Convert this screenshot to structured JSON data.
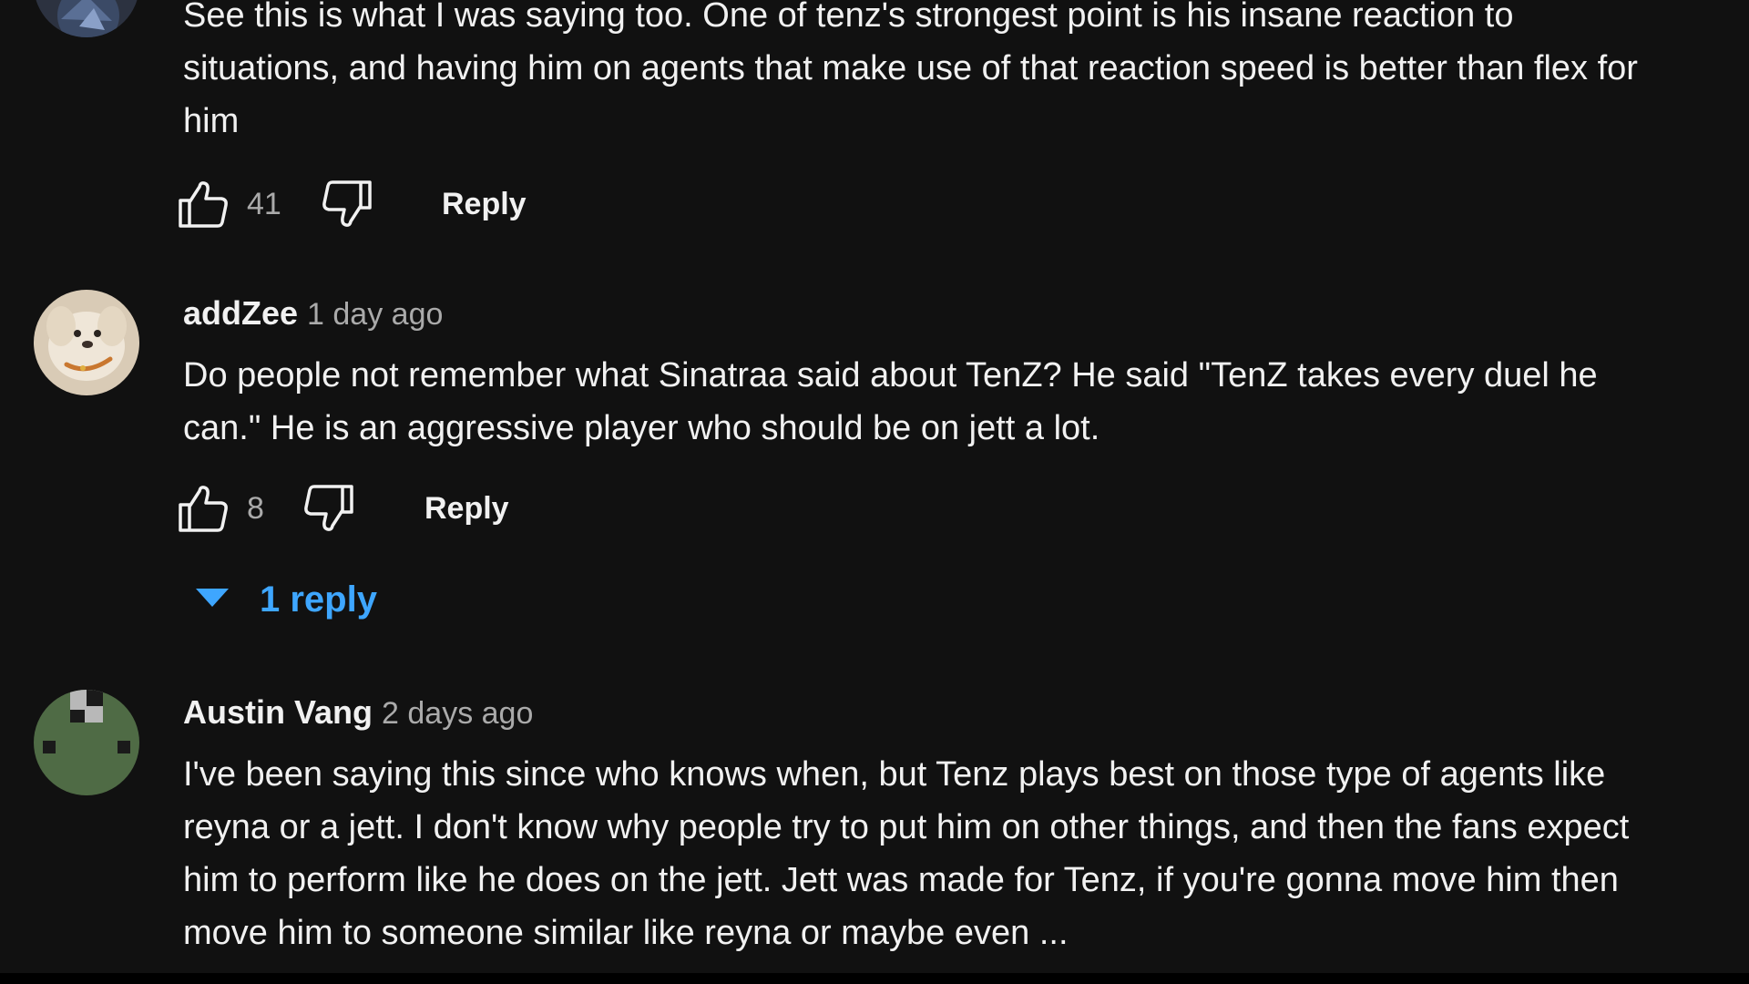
{
  "comments": [
    {
      "author": "",
      "time": "",
      "text": "See this is what I was saying too. One of tenz's strongest point is his insane reaction to situations, and having him on agents that make use of that reaction speed is better than flex for him",
      "likes": "41",
      "reply_label": "Reply",
      "avatar_icon": "avatar-image-partial"
    },
    {
      "author": "addZee",
      "time": "1 day ago",
      "text": "Do people not remember what Sinatraa said about TenZ? He said \"TenZ takes every duel he can.\" He is an aggressive player who should be on jett a lot.",
      "likes": "8",
      "reply_label": "Reply",
      "replies_label": "1 reply",
      "avatar_icon": "dog-avatar"
    },
    {
      "author": "Austin Vang",
      "time": "2 days ago",
      "text": "I've been saying this since who knows when, but Tenz plays best on those type of agents like reyna or a jett. I don't know why people try to put him on other things, and then the fans expect him to perform like he does on the jett. Jett was made for Tenz, if you're gonna move him then move him to someone similar like reyna or maybe even ...",
      "avatar_icon": "green-pixel-avatar"
    }
  ],
  "colors": {
    "background": "#111111",
    "text": "#f1f1f1",
    "secondary_text": "#aaaaaa",
    "link_blue": "#3ea6ff"
  },
  "icons": {
    "like": "thumbs-up-icon",
    "dislike": "thumbs-down-icon",
    "expand": "caret-down-icon"
  }
}
